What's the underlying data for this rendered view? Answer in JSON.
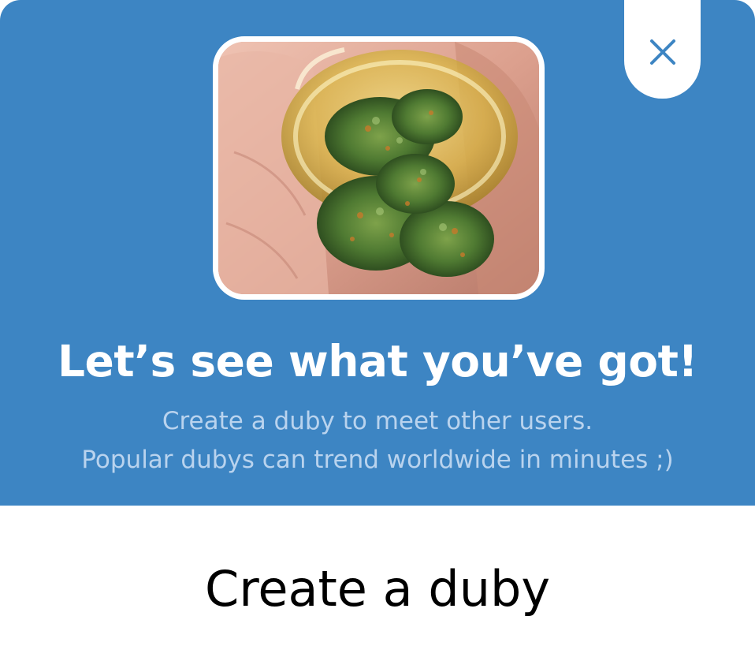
{
  "dialog": {
    "close_icon": "close-icon",
    "image_subject": "jar-of-buds-photo",
    "headline": "Let’s see what you’ve got!",
    "subtitle_line1": "Create a duby to meet other users.",
    "subtitle_line2": "Popular dubys can trend worldwide in minutes ;)",
    "cta_label": "Create a duby"
  },
  "colors": {
    "header_bg": "#3d85c3",
    "subtitle_text": "#b9d3ee",
    "close_icon": "#3d85c3"
  }
}
